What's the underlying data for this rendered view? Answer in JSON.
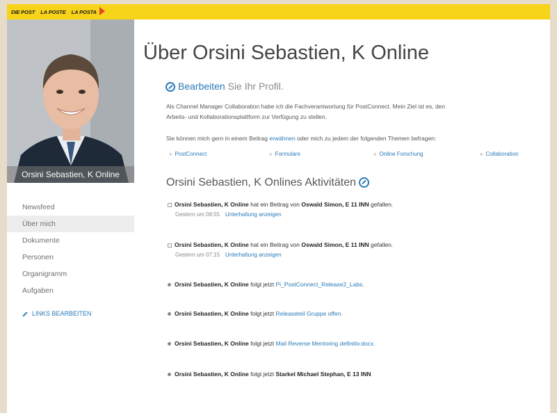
{
  "brand": {
    "items": [
      "DIE POST",
      "LA POSTE",
      "LA POSTA"
    ],
    "color": "#f7d31a",
    "accent": "#e2452b"
  },
  "profile": {
    "caption": "Orsini Sebastien, K Online"
  },
  "nav": {
    "items": [
      "Newsfeed",
      "Über mich",
      "Dokumente",
      "Personen",
      "Organigramm",
      "Aufgaben"
    ],
    "edit_links": "LINKS BEARBEITEN"
  },
  "page": {
    "title": "Über Orsini Sebastien, K Online"
  },
  "edit": {
    "link": "Bearbeiten",
    "rest": " Sie Ihr Profil."
  },
  "about": {
    "line1": "Als Channel Manager Collaboration habe ich die Fachverantwortung für PostConnect. Mein Ziel ist es, den",
    "line2": "Arbeits- und Kollaborationsplattform zur Verfügung zu stellen.",
    "mention_pre": "Sie können mich gern in einem Beitrag ",
    "mention_link": "erwähnen",
    "mention_post": " oder mich zu jedem der folgenden Themen befragen:",
    "tags": [
      "PostConnect",
      "Formulare",
      "Online Forschung",
      "Collaboration"
    ]
  },
  "activities": {
    "heading": "Orsini Sebastien, K Onlines Aktivitäten",
    "items": [
      {
        "actor": "Orsini Sebastien, K Online",
        "verb": " hat ein Beitrag von ",
        "object": "Oswald Simon, E 11 INN",
        "suffix": " gefallen.",
        "time": "Gestern um 08:55",
        "action": "Unterhaltung anzeigen"
      },
      {
        "actor": "Orsini Sebastien, K Online",
        "verb": " hat ein Beitrag von ",
        "object": "Oswald Simon, E 11 INN",
        "suffix": " gefallen.",
        "time": "Gestern um 07:15",
        "action": "Unterhaltung anzeigen"
      },
      {
        "actor": "Orsini Sebastien, K Online",
        "verb": " folgt jetzt ",
        "link": "Pi_PostConnect_Release2_Labs."
      },
      {
        "actor": "Orsini Sebastien, K Online",
        "verb": " folgt jetzt ",
        "link": "Releaseteil Gruppe offen."
      },
      {
        "actor": "Orsini Sebastien, K Online",
        "verb": " folgt jetzt ",
        "link": "Mail Reverse Mentoring definitiv.docx."
      },
      {
        "actor": "Orsini Sebastien, K Online",
        "verb": " folgt jetzt ",
        "bold": "Starkel Michael Stephan, E 13 INN"
      }
    ]
  }
}
